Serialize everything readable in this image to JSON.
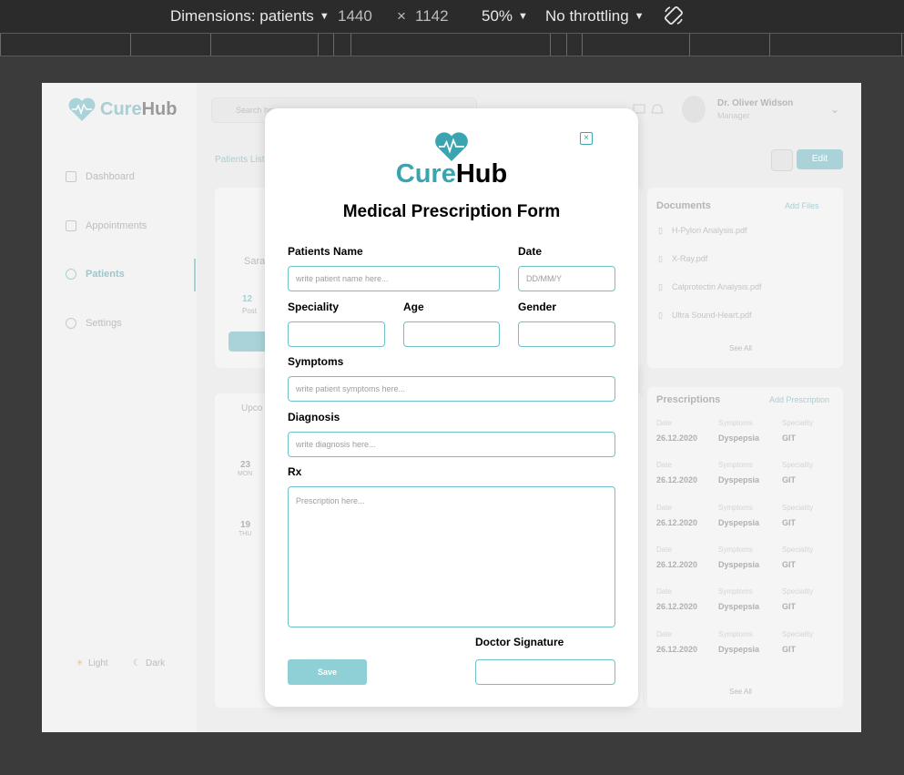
{
  "devtools": {
    "dimensions_label": "Dimensions: patients",
    "width": "1440",
    "times": "×",
    "height": "1142",
    "zoom": "50%",
    "throttling": "No throttling"
  },
  "app": {
    "logo_cure": "Cure",
    "logo_hub": "Hub",
    "search_placeholder": "Search here...",
    "user_name": "Dr. Oliver Widson",
    "user_role": "Manager",
    "nav": [
      {
        "label": "Dashboard"
      },
      {
        "label": "Appointments"
      },
      {
        "label": "Patients"
      },
      {
        "label": "Settings"
      }
    ],
    "theme_light": "Light",
    "theme_dark": "Dark",
    "breadcrumb": "Patients List",
    "edit_label": "Edit",
    "patient_partial_name": "Sara",
    "stat_value": "12",
    "stat_label": "Post",
    "upcoming_label": "Upco",
    "appt1_day": "23",
    "appt1_dow": "MON",
    "appt2_day": "19",
    "appt2_dow": "THU",
    "documents_title": "Documents",
    "add_files": "Add Files",
    "documents": [
      {
        "name": "H-Pylori Analysis.pdf"
      },
      {
        "name": "X-Ray.pdf"
      },
      {
        "name": "Calprotectin Analysis.pdf"
      },
      {
        "name": "Ultra Sound-Heart.pdf"
      }
    ],
    "see_all": "See All",
    "prescriptions_title": "Prescriptions",
    "add_prescription": "Add Prescription",
    "presc_col_date": "Date",
    "presc_col_symptoms": "Symptoms",
    "presc_col_speciality": "Speciality",
    "prescriptions": [
      {
        "date": "26.12.2020",
        "symptoms": "Dyspepsia",
        "speciality": "GIT"
      },
      {
        "date": "26.12.2020",
        "symptoms": "Dyspepsia",
        "speciality": "GIT"
      },
      {
        "date": "26.12.2020",
        "symptoms": "Dyspepsia",
        "speciality": "GIT"
      },
      {
        "date": "26.12.2020",
        "symptoms": "Dyspepsia",
        "speciality": "GIT"
      },
      {
        "date": "26.12.2020",
        "symptoms": "Dyspepsia",
        "speciality": "GIT"
      },
      {
        "date": "26.12.2020",
        "symptoms": "Dyspepsia",
        "speciality": "GIT"
      }
    ]
  },
  "modal": {
    "logo_cure": "Cure",
    "logo_hub": "Hub",
    "title": "Medical Prescription Form",
    "close_symbol": "×",
    "fields": {
      "patient_name_label": "Patients Name",
      "patient_name_placeholder": "write patient name here...",
      "date_label": "Date",
      "date_placeholder": "DD/MM/Y",
      "speciality_label": "Speciality",
      "age_label": "Age",
      "gender_label": "Gender",
      "symptoms_label": "Symptoms",
      "symptoms_placeholder": "write patient symptoms here...",
      "diagnosis_label": "Diagnosis",
      "diagnosis_placeholder": "write diagnosis here...",
      "rx_label": "Rx",
      "rx_placeholder": "Prescription here...",
      "signature_label": "Doctor Signature"
    },
    "save_label": "Save"
  },
  "colors": {
    "accent": "#3aa4b0",
    "input_border": "#6fc1c9",
    "save_button": "#8fcfd6",
    "backdrop": "#3b3b3b"
  }
}
